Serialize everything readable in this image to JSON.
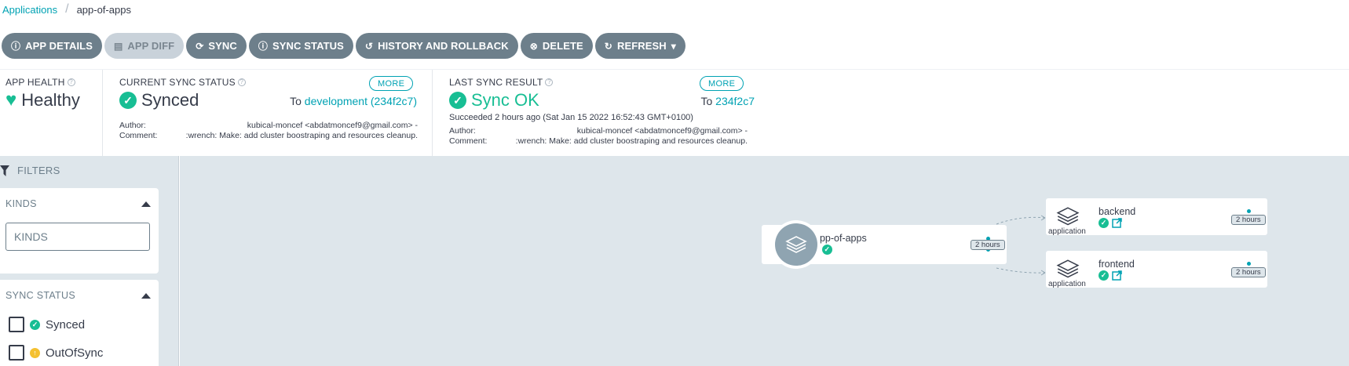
{
  "breadcrumb": {
    "root": "Applications",
    "current": "app-of-apps"
  },
  "toolbar": {
    "app_details": "APP DETAILS",
    "app_diff": "APP DIFF",
    "sync": "SYNC",
    "sync_status": "SYNC STATUS",
    "history": "HISTORY AND ROLLBACK",
    "delete": "DELETE",
    "refresh": "REFRESH"
  },
  "health": {
    "title": "APP HEALTH",
    "value": "Healthy"
  },
  "current_sync": {
    "title": "CURRENT SYNC STATUS",
    "value": "Synced",
    "more": "MORE",
    "to_prefix": "To",
    "target": "development (234f2c7)",
    "author_label": "Author:",
    "author": "kubical-moncef <abdatmoncef9@gmail.com> -",
    "comment_label": "Comment:",
    "comment": ":wrench: Make: add cluster boostraping and resources cleanup."
  },
  "last_sync": {
    "title": "LAST SYNC RESULT",
    "value": "Sync OK",
    "more": "MORE",
    "to_prefix": "To",
    "target": "234f2c7",
    "succeeded": "Succeeded 2 hours ago (Sat Jan 15 2022 16:52:43 GMT+0100)",
    "author_label": "Author:",
    "author": "kubical-moncef <abdatmoncef9@gmail.com> -",
    "comment_label": "Comment:",
    "comment": ":wrench: Make: add cluster boostraping and resources cleanup."
  },
  "filters": {
    "title": "FILTERS",
    "kinds_title": "KINDS",
    "kinds_placeholder": "KINDS",
    "sync_status_title": "SYNC STATUS",
    "options": [
      "Synced",
      "OutOfSync"
    ]
  },
  "graph": {
    "root": {
      "name": "app-of-apps",
      "age": "2 hours"
    },
    "children": [
      {
        "name": "backend",
        "kind": "application",
        "age": "2 hours"
      },
      {
        "name": "frontend",
        "kind": "application",
        "age": "2 hours"
      }
    ]
  },
  "colors": {
    "accent": "#00a2b3",
    "healthy": "#18be94",
    "button": "#6d7f8b",
    "canvas": "#dee6eb"
  }
}
